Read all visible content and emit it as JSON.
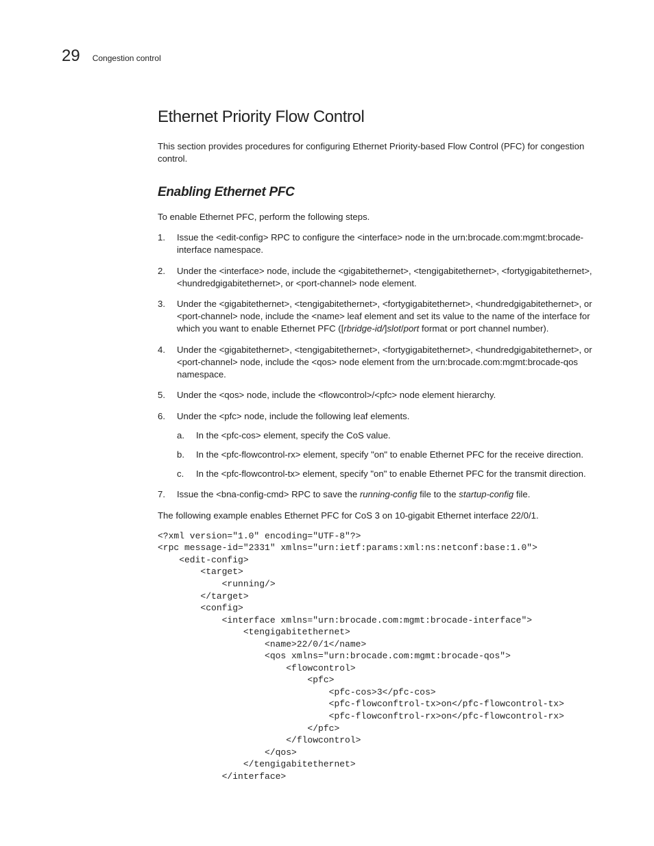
{
  "header": {
    "page_number": "29",
    "section_label": "Congestion control"
  },
  "title": "Ethernet Priority Flow Control",
  "intro": "This section provides procedures for configuring Ethernet Priority-based Flow Control (PFC) for congestion control.",
  "sub_title": "Enabling Ethernet PFC",
  "sub_intro": "To enable Ethernet PFC, perform the following steps.",
  "steps": {
    "s1": "Issue the <edit-config> RPC to configure the <interface> node in the urn:brocade.com:mgmt:brocade-interface namespace.",
    "s2": "Under the <interface> node, include the <gigabitethernet>, <tengigabitethernet>, <fortygigabitethernet>, <hundredgigabitethernet>, or <port-channel> node element.",
    "s3_a": "Under the <gigabitethernet>, <tengigabitethernet>, <fortygigabitethernet>, <hundredgigabitethernet>, or <port-channel> node, include the <name> leaf element and set its value to the name of the interface for which you want to enable Ethernet PFC ([",
    "s3_i1": "rbridge-id/",
    "s3_b": "]",
    "s3_i2": "slot",
    "s3_c": "/",
    "s3_i3": "port",
    "s3_d": " format or port channel number).",
    "s4": "Under the <gigabitethernet>, <tengigabitethernet>, <fortygigabitethernet>, <hundredgigabitethernet>, or <port-channel> node, include the <qos> node element from the urn:brocade.com:mgmt:brocade-qos namespace.",
    "s5": "Under the <qos> node, include the <flowcontrol>/<pfc> node element hierarchy.",
    "s6": "Under the <pfc> node, include the following leaf elements.",
    "s6a": "In the <pfc-cos> element, specify the CoS value.",
    "s6b": "In the <pfc-flowcontrol-rx> element, specify \"on\" to enable Ethernet PFC for the receive direction.",
    "s6c": "In the <pfc-flowcontrol-tx> element, specify \"on\" to enable Ethernet PFC for the transmit direction.",
    "s7_a": "Issue the <bna-config-cmd> RPC to save the ",
    "s7_i1": "running-config",
    "s7_b": " file to the ",
    "s7_i2": "startup-config",
    "s7_c": " file."
  },
  "example_intro": "The following example enables Ethernet PFC for CoS 3 on 10-gigabit Ethernet interface 22/0/1.",
  "code": "<?xml version=\"1.0\" encoding=\"UTF-8\"?>\n<rpc message-id=\"2331\" xmlns=\"urn:ietf:params:xml:ns:netconf:base:1.0\">\n    <edit-config>\n        <target>\n            <running/>\n        </target>\n        <config>\n            <interface xmlns=\"urn:brocade.com:mgmt:brocade-interface\">\n                <tengigabitethernet>\n                    <name>22/0/1</name>\n                    <qos xmlns=\"urn:brocade.com:mgmt:brocade-qos\">\n                        <flowcontrol>\n                            <pfc>\n                                <pfc-cos>3</pfc-cos>\n                                <pfc-flowconftrol-tx>on</pfc-flowcontrol-tx>\n                                <pfc-flowconftrol-rx>on</pfc-flowcontrol-rx>\n                            </pfc>\n                        </flowcontrol>\n                    </qos>\n                </tengigabitethernet>\n            </interface>"
}
